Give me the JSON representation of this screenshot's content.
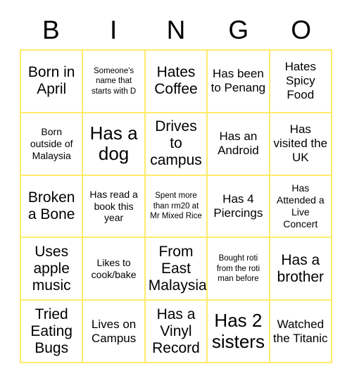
{
  "card": {
    "title": "BINGO",
    "header_letters": [
      "B",
      "I",
      "N",
      "G",
      "O"
    ],
    "border_color": "#ffeb6b",
    "text_color": "#000000",
    "background_color": "#ffffff",
    "columns": 5,
    "rows": 5,
    "cells": [
      {
        "text": "Born in April",
        "size": "lg"
      },
      {
        "text": "Someone's name that starts with D",
        "size": "xs"
      },
      {
        "text": "Hates Coffee",
        "size": "lg"
      },
      {
        "text": "Has been to Penang",
        "size": "md"
      },
      {
        "text": "Hates Spicy Food",
        "size": "md"
      },
      {
        "text": "Born outside of Malaysia",
        "size": "sm"
      },
      {
        "text": "Has a dog",
        "size": "xl"
      },
      {
        "text": "Drives to campus",
        "size": "lg"
      },
      {
        "text": "Has an Android",
        "size": "md"
      },
      {
        "text": "Has visited the UK",
        "size": "md"
      },
      {
        "text": "Broken a Bone",
        "size": "lg"
      },
      {
        "text": "Has read a book this year",
        "size": "sm"
      },
      {
        "text": "Spent more than rm20 at Mr Mixed Rice",
        "size": "xs"
      },
      {
        "text": "Has 4 Piercings",
        "size": "md"
      },
      {
        "text": "Has Attended a Live Concert",
        "size": "sm"
      },
      {
        "text": "Uses apple music",
        "size": "lg"
      },
      {
        "text": "Likes to cook/bake",
        "size": "sm"
      },
      {
        "text": "From East Malaysia",
        "size": "lg"
      },
      {
        "text": "Bought roti from the roti man before",
        "size": "xs"
      },
      {
        "text": "Has a brother",
        "size": "lg"
      },
      {
        "text": "Tried Eating Bugs",
        "size": "lg"
      },
      {
        "text": "Lives on Campus",
        "size": "md"
      },
      {
        "text": "Has a Vinyl Record",
        "size": "lg"
      },
      {
        "text": "Has 2 sisters",
        "size": "xl"
      },
      {
        "text": "Watched the Titanic",
        "size": "md"
      }
    ]
  }
}
